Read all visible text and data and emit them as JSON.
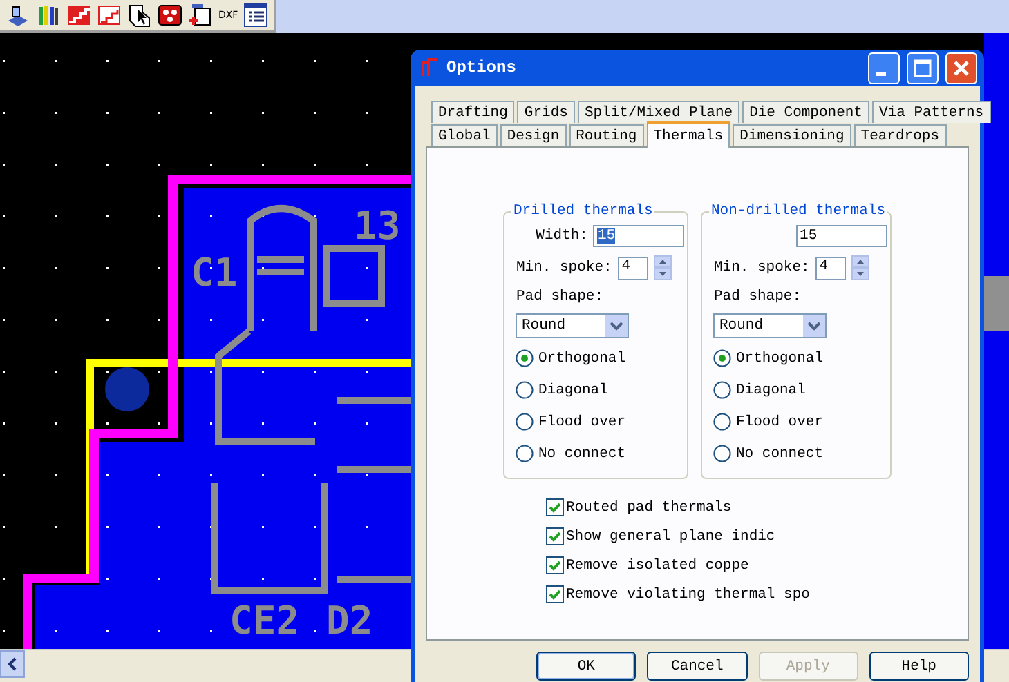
{
  "toolbar": {
    "items": [
      {
        "kind": "layers"
      },
      {
        "kind": "books"
      },
      {
        "kind": "stairs"
      },
      {
        "kind": "stairs_outline"
      },
      {
        "kind": "pointer"
      },
      {
        "kind": "chip"
      },
      {
        "kind": "board"
      },
      {
        "kind": "text",
        "label": "DXF"
      },
      {
        "kind": "list"
      }
    ]
  },
  "pcb": {
    "silkscreen": [
      "C1",
      "13",
      "CE2",
      "D2"
    ]
  },
  "dialog": {
    "title": "Options",
    "tab_rows": [
      [
        {
          "label": "Drafting",
          "selected": false
        },
        {
          "label": "Grids",
          "selected": false
        },
        {
          "label": "Split/Mixed Plane",
          "selected": false
        },
        {
          "label": "Die Component",
          "selected": false
        },
        {
          "label": "Via Patterns",
          "selected": false
        }
      ],
      [
        {
          "label": "Global",
          "selected": false
        },
        {
          "label": "Design",
          "selected": false
        },
        {
          "label": "Routing",
          "selected": false
        },
        {
          "label": "Thermals",
          "selected": true
        },
        {
          "label": "Dimensioning",
          "selected": false
        },
        {
          "label": "Teardrops",
          "selected": false
        }
      ]
    ],
    "groups": [
      {
        "title": "Drilled thermals",
        "width_label": "Width:",
        "width_value": "15",
        "value_highlighted": true,
        "spoke_label": "Min. spoke:",
        "spoke_value": "4",
        "shape_label": "Pad shape:",
        "shape_value": "Round",
        "options": [
          {
            "label": "Orthogonal",
            "selected": true
          },
          {
            "label": "Diagonal",
            "selected": false
          },
          {
            "label": "Flood over",
            "selected": false
          },
          {
            "label": "No connect",
            "selected": false
          }
        ]
      },
      {
        "title": "Non-drilled thermals",
        "width_value": "15",
        "value_highlighted": false,
        "spoke_label": "Min. spoke:",
        "spoke_value": "4",
        "shape_label": "Pad shape:",
        "shape_value": "Round",
        "options": [
          {
            "label": "Orthogonal",
            "selected": true
          },
          {
            "label": "Diagonal",
            "selected": false
          },
          {
            "label": "Flood over",
            "selected": false
          },
          {
            "label": "No connect",
            "selected": false
          }
        ]
      }
    ],
    "checkboxes": [
      {
        "label": "Routed pad thermals",
        "checked": true
      },
      {
        "label": "Show general plane indic",
        "checked": true
      },
      {
        "label": "Remove isolated coppe",
        "checked": true
      },
      {
        "label": "Remove violating thermal spo",
        "checked": true
      }
    ],
    "buttons": [
      {
        "label": "OK",
        "disabled": false,
        "default": true
      },
      {
        "label": "Cancel",
        "disabled": false,
        "default": false
      },
      {
        "label": "Apply",
        "disabled": true,
        "default": false
      },
      {
        "label": "Help",
        "disabled": false,
        "default": false
      }
    ]
  }
}
